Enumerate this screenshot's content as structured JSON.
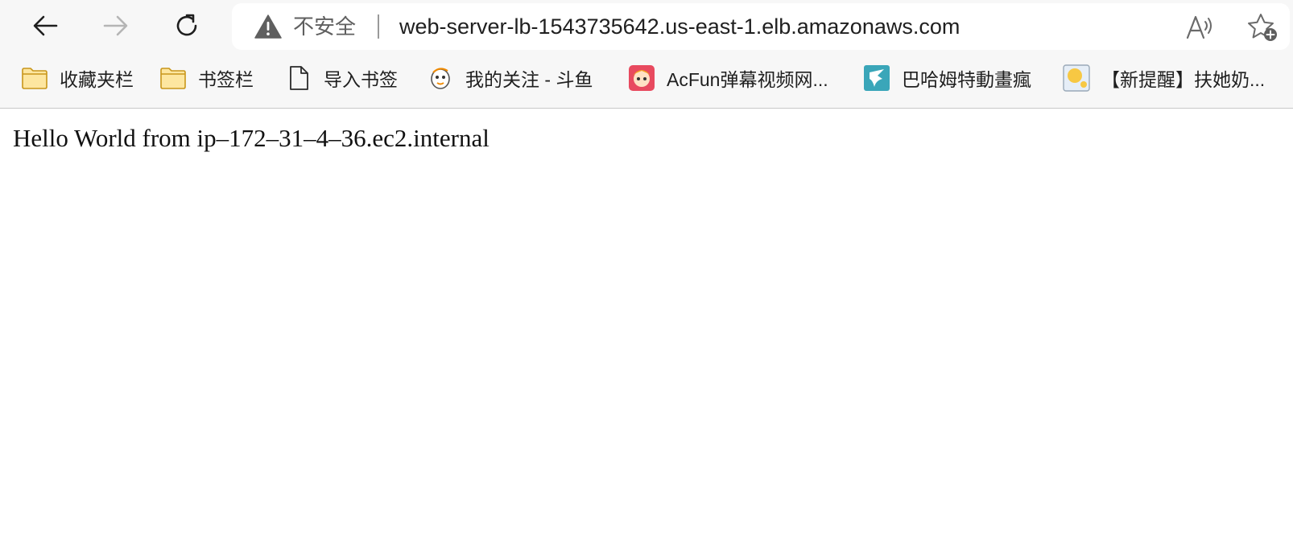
{
  "address_bar": {
    "security_label": "不安全",
    "url": "web-server-lb-1543735642.us-east-1.elb.amazonaws.com"
  },
  "bookmarks": [
    {
      "label": "收藏夹栏",
      "icon": "folder-icon"
    },
    {
      "label": "书签栏",
      "icon": "folder-icon"
    },
    {
      "label": "导入书签",
      "icon": "file-icon"
    },
    {
      "label": "我的关注 - 斗鱼",
      "icon": "douyu-icon"
    },
    {
      "label": "AcFun弹幕视频网...",
      "icon": "acfun-icon"
    },
    {
      "label": "巴哈姆特動畫瘋",
      "icon": "bahamut-icon"
    },
    {
      "label": "【新提醒】扶她奶...",
      "icon": "site-icon"
    }
  ],
  "page": {
    "body_text": "Hello World from ip–172–31–4–36.ec2.internal"
  },
  "colors": {
    "chrome_bg": "#f7f7f7",
    "folder": "#f5c518",
    "acfun": "#e84a5f",
    "bahamut": "#3aa6b9"
  }
}
